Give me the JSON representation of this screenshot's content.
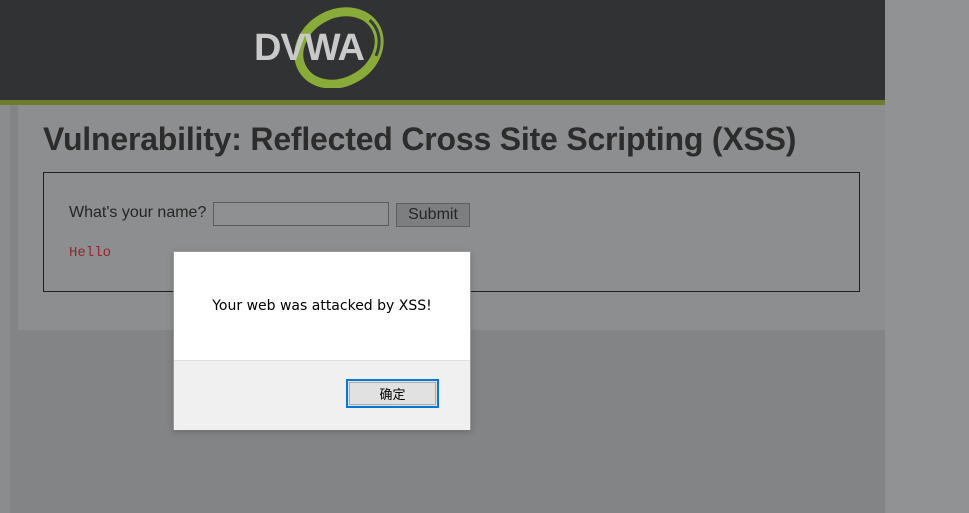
{
  "header": {
    "logo_text": "DVWA",
    "colors": {
      "background": "#313233",
      "accent_stripe": "#6b7e2f",
      "logo_swoosh": "#8db23a"
    }
  },
  "main": {
    "page_title": "Vulnerability: Reflected Cross Site Scripting (XSS)",
    "form": {
      "name_label": "What's your name?",
      "name_input_value": "",
      "submit_label": "Submit"
    },
    "output_text": "Hello",
    "colors": {
      "output_text": "#8e2a2a"
    }
  },
  "alert_dialog": {
    "message": "Your web was attacked by XSS!",
    "ok_label": "确定",
    "colors": {
      "focus_border": "#0078d7"
    }
  }
}
